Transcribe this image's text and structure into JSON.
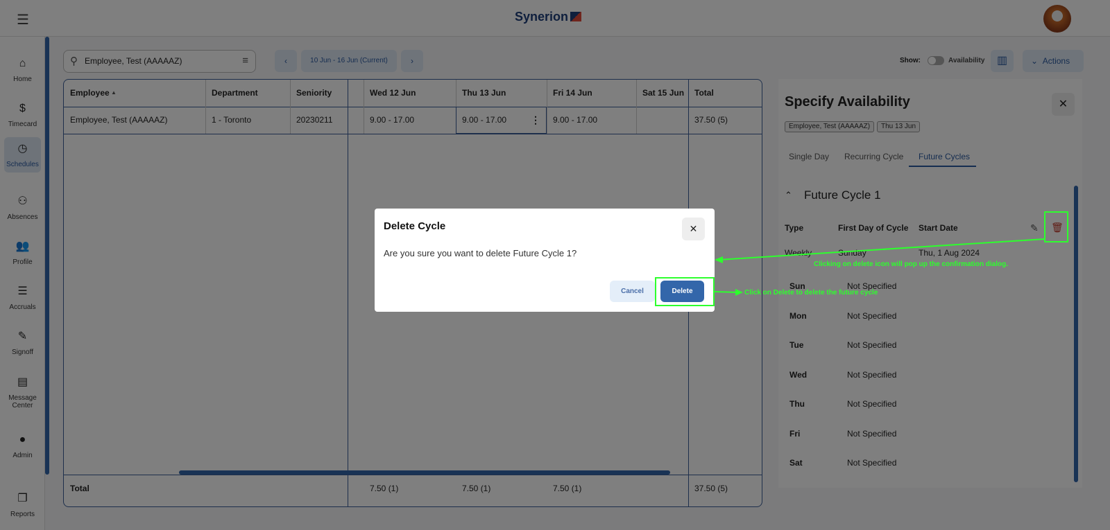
{
  "header": {
    "brand": "Synerion"
  },
  "sidebar": {
    "items": [
      {
        "label": "Home",
        "icon": "⌂"
      },
      {
        "label": "Timecard",
        "icon": "$"
      },
      {
        "label": "Schedules",
        "icon": "◷",
        "active": true
      },
      {
        "label": "Absences",
        "icon": "⚇"
      },
      {
        "label": "Profile",
        "icon": "👥"
      },
      {
        "label": "Accruals",
        "icon": "☰"
      },
      {
        "label": "Signoff",
        "icon": "✎"
      },
      {
        "label": "Message Center",
        "icon": "▤"
      },
      {
        "label": "Admin",
        "icon": "●"
      },
      {
        "label": "Reports",
        "icon": "❐"
      }
    ]
  },
  "toolbar": {
    "search_value": "Employee, Test (AAAAAZ)",
    "prev": "‹",
    "range": "10 Jun - 16 Jun (Current)",
    "next": "›",
    "show_label": "Show:",
    "availability_label": "Availability",
    "availability_on": false,
    "actions_label": "Actions"
  },
  "table": {
    "headers": [
      "Employee",
      "Department",
      "Seniority",
      "",
      "Wed 12 Jun",
      "Thu 13 Jun",
      "Fri 14 Jun",
      "Sat 15 Jun",
      "Total"
    ],
    "row": [
      "Employee, Test (AAAAAZ)",
      "1 - Toronto",
      "20230211",
      "",
      "9.00 - 17.00",
      "9.00 - 17.00",
      "9.00 - 17.00",
      "",
      "37.50 (5)"
    ],
    "totals": [
      "Total",
      "",
      "",
      "",
      "7.50 (1)",
      "7.50 (1)",
      "7.50 (1)",
      "",
      "37.50 (5)"
    ]
  },
  "panel": {
    "title": "Specify Availability",
    "chips": [
      "Employee, Test (AAAAAZ)",
      "Thu 13 Jun"
    ],
    "tabs": [
      "Single Day",
      "Recurring Cycle",
      "Future Cycles"
    ],
    "active_tab": "Future Cycles",
    "cycle_title": "Future Cycle 1",
    "columns": [
      "Type",
      "First Day of Cycle",
      "Start Date"
    ],
    "values": [
      "Weekly",
      "Sunday",
      "Thu, 1 Aug 2024"
    ],
    "days": [
      {
        "d": "Sun",
        "v": "Not Specified"
      },
      {
        "d": "Mon",
        "v": "Not Specified"
      },
      {
        "d": "Tue",
        "v": "Not Specified"
      },
      {
        "d": "Wed",
        "v": "Not Specified"
      },
      {
        "d": "Thu",
        "v": "Not Specified"
      },
      {
        "d": "Fri",
        "v": "Not Specified"
      },
      {
        "d": "Sat",
        "v": "Not Specified"
      }
    ]
  },
  "dialog": {
    "title": "Delete Cycle",
    "message": "Are you sure you want to delete Future Cycle 1?",
    "cancel": "Cancel",
    "delete": "Delete"
  },
  "annotations": {
    "delete_icon_note": "Clicking on delete icon will pop up the confirmation dialog.",
    "delete_button_note": "Click on Delete to delete the future cycle",
    "color": "#2dff2d"
  }
}
